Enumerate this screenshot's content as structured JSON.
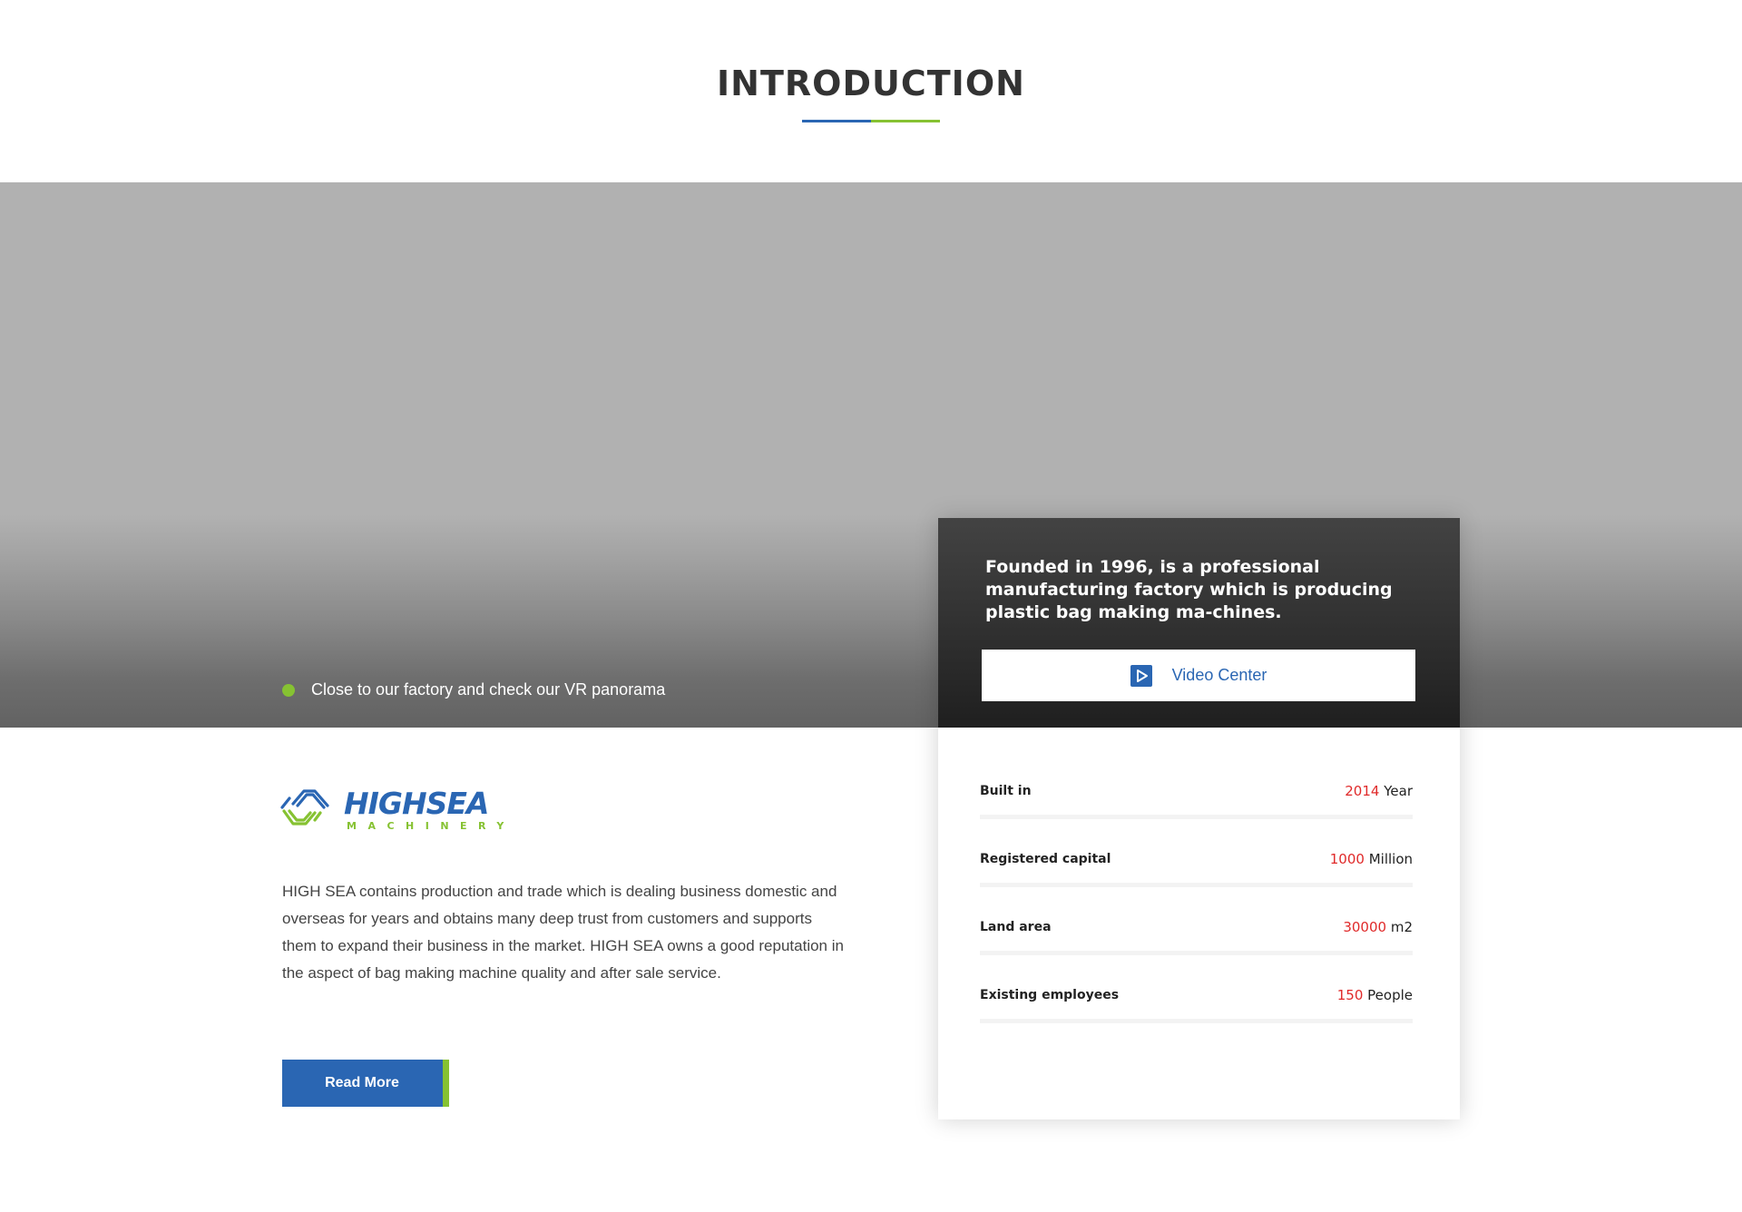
{
  "section": {
    "title": "INTRODUCTION",
    "accent_colors": [
      "#2a66b3",
      "#86c232"
    ]
  },
  "hero": {
    "vr_text": "Close to our factory and check our VR panorama"
  },
  "card": {
    "description": "Founded in 1996, is a professional manufacturing factory which is producing plastic bag making ma-chines.",
    "video_button_label": "Video Center",
    "video_icon": "play-icon",
    "stats": [
      {
        "label": "Built in",
        "value": "2014",
        "unit": "Year"
      },
      {
        "label": "Registered capital",
        "value": "1000",
        "unit": "Million"
      },
      {
        "label": "Land area",
        "value": "30000",
        "unit": "m2"
      },
      {
        "label": "Existing employees",
        "value": "150",
        "unit": "People"
      }
    ]
  },
  "about": {
    "logo_text": "HIGHSEA",
    "logo_subtext": "MACHINERY",
    "paragraph": "HIGH SEA contains production and trade which is dealing business domestic and overseas for years and obtains many deep trust from customers and supports them to expand their business in the market. HIGH SEA owns a good reputation in the aspect of bag making machine quality and after sale service.",
    "read_more_label": "Read More"
  },
  "colors": {
    "brand_blue": "#2a66b3",
    "brand_green": "#86c232",
    "highlight_red": "#e02a2a"
  }
}
